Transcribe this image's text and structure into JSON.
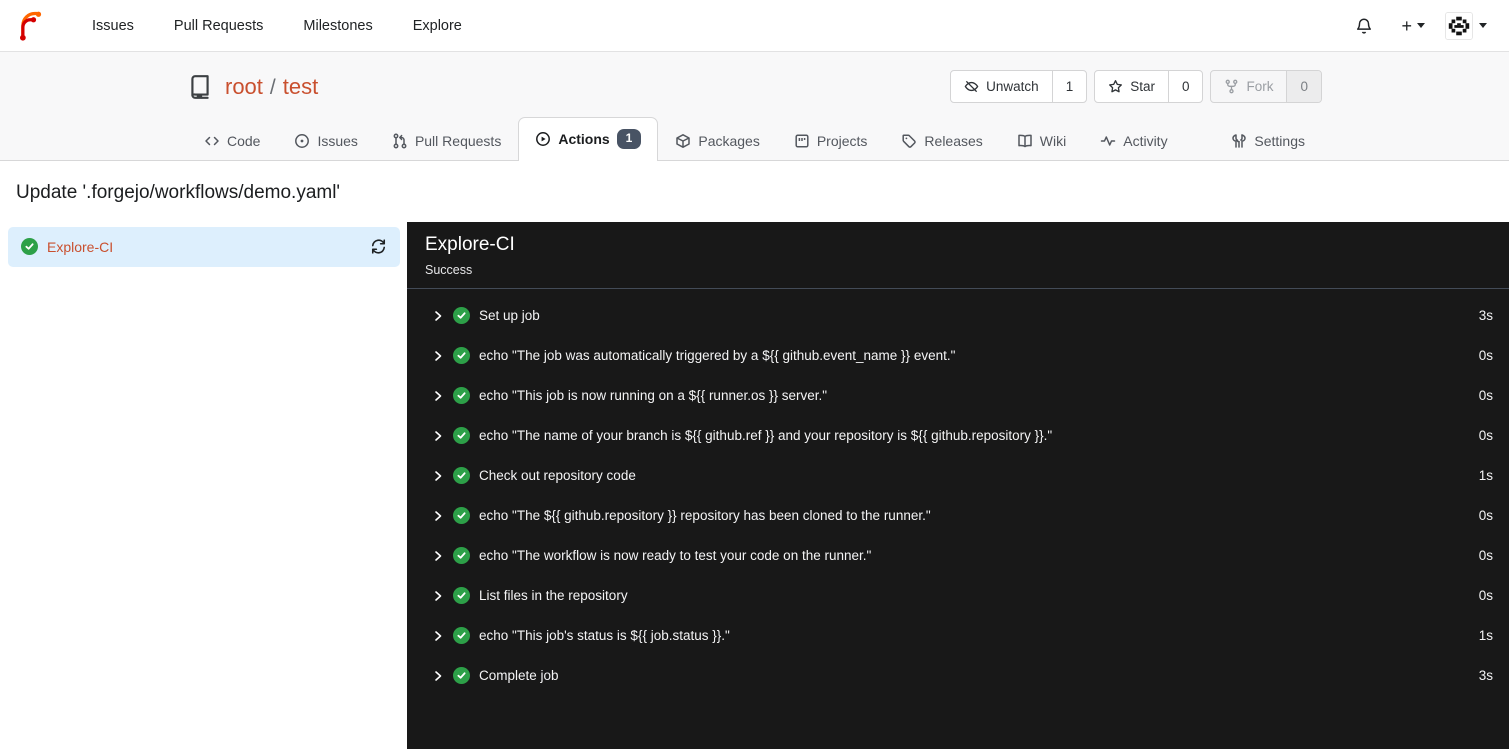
{
  "navbar": {
    "items": [
      {
        "label": "Issues"
      },
      {
        "label": "Pull Requests"
      },
      {
        "label": "Milestones"
      },
      {
        "label": "Explore"
      }
    ],
    "plus_label": "+"
  },
  "repo": {
    "owner": "root",
    "separator": "/",
    "name": "test",
    "actions": [
      {
        "label": "Unwatch",
        "count": "1"
      },
      {
        "label": "Star",
        "count": "0"
      },
      {
        "label": "Fork",
        "count": "0",
        "disabled": true
      }
    ]
  },
  "tabs": {
    "code": {
      "label": "Code"
    },
    "issues": {
      "label": "Issues"
    },
    "pulls": {
      "label": "Pull Requests"
    },
    "actions": {
      "label": "Actions",
      "badge": "1"
    },
    "packages": {
      "label": "Packages"
    },
    "projects": {
      "label": "Projects"
    },
    "releases": {
      "label": "Releases"
    },
    "wiki": {
      "label": "Wiki"
    },
    "activity": {
      "label": "Activity"
    },
    "settings": {
      "label": "Settings"
    }
  },
  "run": {
    "title": "Update '.forgejo/workflows/demo.yaml'"
  },
  "sidebar": {
    "job": {
      "name": "Explore-CI"
    }
  },
  "panel": {
    "title": "Explore-CI",
    "status": "Success",
    "steps": [
      {
        "name": "Set up job",
        "duration": "3s"
      },
      {
        "name": "echo \"The job was automatically triggered by a ${{ github.event_name }} event.\"",
        "duration": "0s"
      },
      {
        "name": "echo \"This job is now running on a ${{ runner.os }} server.\"",
        "duration": "0s"
      },
      {
        "name": "echo \"The name of your branch is ${{ github.ref }} and your repository is ${{ github.repository }}.\"",
        "duration": "0s"
      },
      {
        "name": "Check out repository code",
        "duration": "1s"
      },
      {
        "name": "echo \"The ${{ github.repository }} repository has been cloned to the runner.\"",
        "duration": "0s"
      },
      {
        "name": "echo \"The workflow is now ready to test your code on the runner.\"",
        "duration": "0s"
      },
      {
        "name": "List files in the repository",
        "duration": "0s"
      },
      {
        "name": "echo \"This job's status is ${{ job.status }}.\"",
        "duration": "1s"
      },
      {
        "name": "Complete job",
        "duration": "3s"
      }
    ]
  },
  "colors": {
    "accent": "#c9502f",
    "panel-bg": "#181818",
    "success-green": "#2da048",
    "job-selected-bg": "#ddeffd",
    "badge-bg": "#485364"
  }
}
